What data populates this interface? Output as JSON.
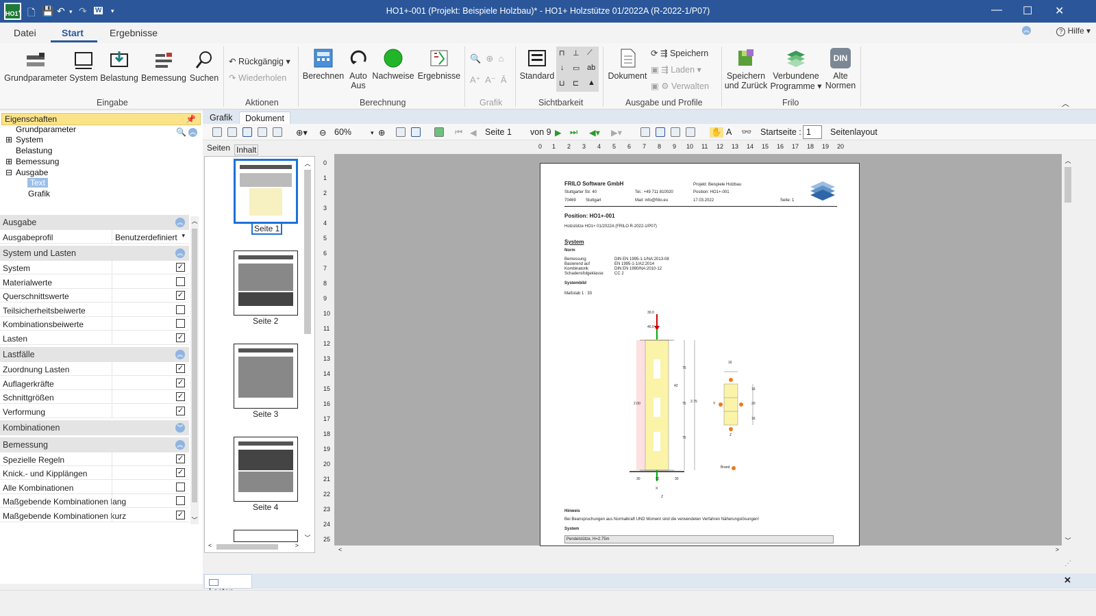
{
  "window": {
    "title": "HO1+-001 (Projekt: Beispiele Holzbau)* - HO1+ Holzstütze 01/2022A (R-2022-1/P07)",
    "logo": "HO1",
    "logo_sup": "+"
  },
  "menu": {
    "tabs": [
      "Datei",
      "Start",
      "Ergebnisse"
    ],
    "active": "Start",
    "help": "Hilfe"
  },
  "ribbon": {
    "eingabe": {
      "label": "Eingabe",
      "buttons": [
        "Grundparameter",
        "System",
        "Belastung",
        "Bemessung",
        "Suchen"
      ]
    },
    "aktionen": {
      "label": "Aktionen",
      "undo": "Rückgängig",
      "redo": "Wiederholen"
    },
    "berechnung": {
      "label": "Berechnung",
      "buttons": [
        "Berechnen",
        "Auto",
        "Aus",
        "Nachweise",
        "Ergebnisse"
      ]
    },
    "grafik": {
      "label": "Grafik"
    },
    "sichtbarkeit": {
      "label": "Sichtbarkeit",
      "standard": "Standard"
    },
    "ausgabe": {
      "label": "Ausgabe und Profile",
      "dokument": "Dokument",
      "speichern": "Speichern",
      "laden": "Laden",
      "verwalten": "Verwalten"
    },
    "frilo": {
      "label": "Frilo",
      "speichern_zurueck_1": "Speichern",
      "speichern_zurueck_2": "und Zurück",
      "verbundene_1": "Verbundene",
      "verbundene_2": "Programme",
      "alte_1": "Alte",
      "alte_2": "Normen",
      "din": "DIN"
    }
  },
  "properties": {
    "header": "Eigenschaften",
    "tree": [
      "Grundparameter",
      "System",
      "Belastung",
      "Bemessung",
      "Ausgabe",
      "Text",
      "Grafik"
    ],
    "sections": [
      {
        "title": "Ausgabe",
        "rows": [
          {
            "label": "Ausgabeprofil",
            "value": "Benutzerdefiniert"
          }
        ]
      },
      {
        "title": "System und Lasten",
        "rows": [
          {
            "label": "System",
            "checked": "✓"
          },
          {
            "label": "Materialwerte",
            "checked": ""
          },
          {
            "label": "Querschnittswerte",
            "checked": "✓"
          },
          {
            "label": "Teilsicherheitsbeiwerte",
            "checked": ""
          },
          {
            "label": "Kombinationsbeiwerte",
            "checked": ""
          },
          {
            "label": "Lasten",
            "checked": "✓"
          }
        ]
      },
      {
        "title": "Lastfälle",
        "rows": [
          {
            "label": "Zuordnung Lasten",
            "checked": "✓"
          },
          {
            "label": "Auflagerkräfte",
            "checked": "✓"
          },
          {
            "label": "Schnittgrößen",
            "checked": "✓"
          },
          {
            "label": "Verformung",
            "checked": "✓"
          }
        ]
      },
      {
        "title": "Kombinationen",
        "rows": []
      },
      {
        "title": "Bemessung",
        "rows": [
          {
            "label": "Spezielle Regeln",
            "checked": "✓"
          },
          {
            "label": "Knick.- und Kipplängen",
            "checked": "✓"
          },
          {
            "label": "Alle Kombinationen",
            "checked": ""
          },
          {
            "label": "Maßgebende Kombinationen lang",
            "checked": ""
          },
          {
            "label": "Maßgebende Kombinationen kurz",
            "checked": "✓"
          }
        ]
      }
    ]
  },
  "doc_tabs": [
    "Grafik",
    "Dokument"
  ],
  "doc_toolbar": {
    "zoom": "60%",
    "seite_label": "Seite",
    "seite_value": "1",
    "von": "von 9",
    "startseite_label": "Startseite :",
    "startseite_value": "1",
    "seitenlayout": "Seitenlayout"
  },
  "thumb_tabs": [
    "Seiten",
    "Inhalt"
  ],
  "thumbs": [
    "Seite 1",
    "Seite 2",
    "Seite 3",
    "Seite 4"
  ],
  "ruler": [
    "0",
    "1",
    "2",
    "3",
    "4",
    "5",
    "6",
    "7",
    "8",
    "9",
    "10",
    "11",
    "12",
    "13",
    "14",
    "15",
    "16",
    "17",
    "18",
    "19",
    "20"
  ],
  "vruler": [
    "0",
    "1",
    "2",
    "3",
    "4",
    "5",
    "6",
    "7",
    "8",
    "9",
    "10",
    "11",
    "12",
    "13",
    "14",
    "15",
    "16",
    "17",
    "18",
    "19",
    "20",
    "21",
    "22",
    "23",
    "24",
    "25"
  ],
  "document": {
    "company": "FRILO Software GmbH",
    "street": "Stuttgarter Str. 40",
    "zip": "70469",
    "city": "Stuttgart",
    "tel": "Tel.: +49 711 810020",
    "mail": "Mail: info@frilo.eu",
    "projekt": "Projekt: Beispiele Holzbau",
    "position_hdr": "Position: HO1+-001",
    "date": "17.03.2022",
    "seite": "Seite: 1",
    "position": "Position: HO1+-001",
    "subtitle": "Holzstütze HO1+ 01/2022A (FRILO R-2022-1/P07)",
    "system": "System",
    "norm": "Norm",
    "norm_rows": [
      {
        "k": "Bemessung",
        "v": "DIN EN 1995-1-1/NA:2013-08"
      },
      {
        "k": "Basierend auf",
        "v": "EN 1995-1-1/A2:2014"
      },
      {
        "k": "Kombinatorik",
        "v": "DIN EN 1990/NA:2010-12"
      },
      {
        "k": "Schadensfolgeklasse",
        "v": "CC 2"
      }
    ],
    "systembild": "Systembild",
    "massstab": "Maßstab   1 : 33",
    "dims": {
      "d300": "30.0",
      "d400": "40.0",
      "d200": "2.00",
      "d275": "2.75",
      "d16": "16",
      "d76a": "76",
      "d42": "42",
      "d76b": "76",
      "d76c": "76",
      "b30a": "30",
      "b52": "52",
      "b30b": "30",
      "r16a": "16",
      "r20": "20",
      "r16b": "16",
      "y": "Y",
      "z": "Z",
      "x": "X",
      "z2": "Z",
      "brand": "Brand"
    },
    "hinweis": "Hinweis",
    "hinweis_text": "Bei Beanspruchungen aus Normalkraft UND Moment sind die verwendeten Verfahren Näherungslösungen!",
    "system2": "System",
    "pendel": "Pendelstütze, H=2.75m"
  },
  "bottom": {
    "tab": "Lasten"
  }
}
